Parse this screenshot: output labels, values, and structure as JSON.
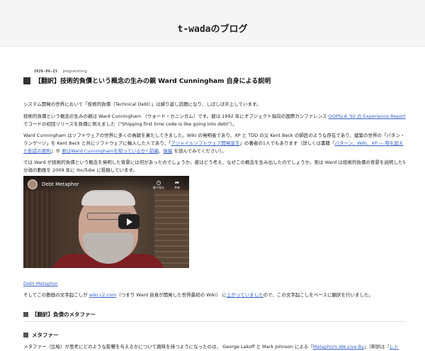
{
  "site": {
    "title": "t-wadaのブログ"
  },
  "post": {
    "date": "2020-06-23",
    "category": "programming",
    "title": "【翻訳】技術的負債という概念の生みの親 Ward Cunningham 自身による説明"
  },
  "p1": {
    "text": "システム開発の世界において「技術的負債（Technical Debt）」は繰り返し話題になり、しばしば炎上しています。"
  },
  "p2": {
    "t1": "技術的負債という概念の生みの親は Ward Cunningham （ウォード・カニンガム）です。彼は 1992 年にオブジェクト指向の国際カンファレンス ",
    "link": "OOPSLA '92 の Experience Report",
    "t2": " でコードの初回リリースを負債に例えました（\"Shipping first time code is like going into debt\"）。"
  },
  "p3": {
    "t1": "Ward Cunningham はソフトウェアの世界に多くの貢献を果たしてきました。Wiki の発明者であり、XP と TDD の父 Kent Beck の師匠のような存在であり、建築の世界の「パタン・ランゲージ」を Kent Beck と共にソフトウェアに輸入した人であり、「",
    "link1": "アジャイルソフトウェア開発宣言",
    "t2": "」の著者の1人でもあります（詳しくは書籍『",
    "link2": "パターン、Wiki、XP ― 時を超えた創造の原則",
    "t3": "』や ",
    "link3": "君はWard Cunninghamを知っているか? 前編",
    "t4": "、",
    "link4": "後編",
    "t5": " を読んでみてください）。"
  },
  "p4": {
    "text": "では Ward が技術的負債という概念を発明した背景には何があったのでしょうか。彼はどう考え、なぜこの概念を生み出したのでしょうか。実は Ward は技術的負債の背景を説明した5分弱の動画を 2009 年に YouTube に投稿しています。"
  },
  "video": {
    "title": "Debt Metaphor",
    "watch_later": "後で見る",
    "share": "共有",
    "watch_later_icon": "clock-icon",
    "share_icon": "share-icon",
    "play_icon": "play-icon"
  },
  "video_link": {
    "label": "Debt Metaphor"
  },
  "p5": {
    "t1": "そしてこの動画の文字起こしが ",
    "link1": "wiki.c2.com",
    "t2": "（つまり Ward 自身が開発した世界最初の Wiki） に",
    "link2": "上がっていました",
    "t3": "ので、この文字起こしをベースに翻訳を行いました。"
  },
  "section1": {
    "title": "【翻訳】負債のメタファー"
  },
  "section2": {
    "title": "メタファー"
  },
  "p6": {
    "t1": "メタファー（比喩）が思考にどのような影響を与えるかについて興味を持つようになったのは、 George Lakoff と Mark Johnson による『",
    "link1": "Metaphors We Live By",
    "t2": "』（邦訳は『",
    "link2": "レト"
  },
  "colors": {
    "link": "#3560c8",
    "header_bg": "#f5f5f5",
    "text": "#222222"
  }
}
